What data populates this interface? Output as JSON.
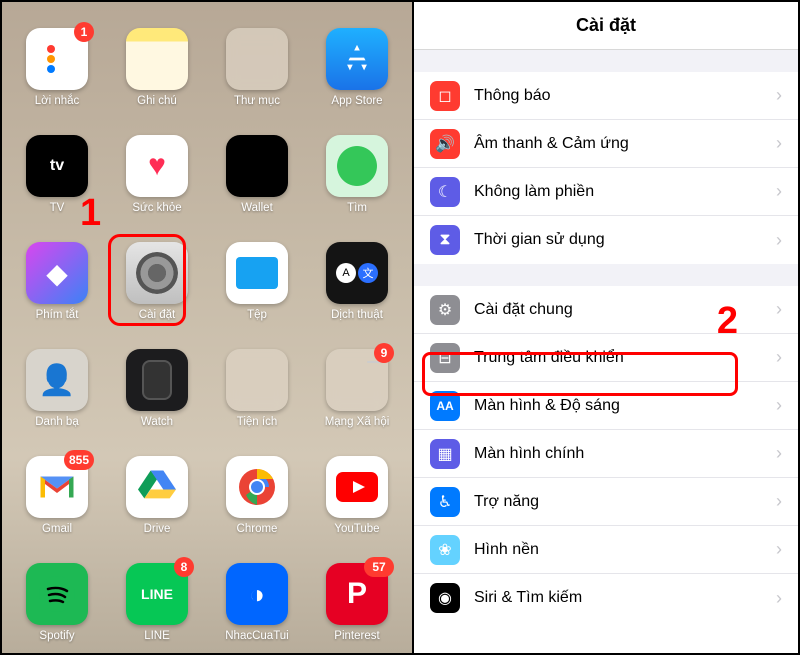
{
  "annotations": {
    "num1": "1",
    "num2": "2"
  },
  "home": {
    "apps": [
      {
        "label": "Lời nhắc",
        "badge": "1"
      },
      {
        "label": "Ghi chú"
      },
      {
        "label": "Thư mục"
      },
      {
        "label": "App Store"
      },
      {
        "label": "TV"
      },
      {
        "label": "Sức khỏe"
      },
      {
        "label": "Wallet"
      },
      {
        "label": "Tìm"
      },
      {
        "label": "Phím tắt"
      },
      {
        "label": "Cài đặt"
      },
      {
        "label": "Tệp"
      },
      {
        "label": "Dịch thuật"
      },
      {
        "label": "Danh bạ"
      },
      {
        "label": "Watch"
      },
      {
        "label": "Tiện ích"
      },
      {
        "label": "Mạng Xã hội",
        "badge": "9"
      },
      {
        "label": "Gmail",
        "badge": "855"
      },
      {
        "label": "Drive"
      },
      {
        "label": "Chrome"
      },
      {
        "label": "YouTube"
      },
      {
        "label": "Spotify"
      },
      {
        "label": "LINE",
        "badge": "8"
      },
      {
        "label": "NhacCuaTui"
      },
      {
        "label": "Pinterest",
        "badge": "57"
      }
    ]
  },
  "settings": {
    "title": "Cài đặt",
    "group1": [
      {
        "icon": "notification-icon",
        "color": "c-red",
        "glyph": "◻",
        "label": "Thông báo"
      },
      {
        "icon": "sound-icon",
        "color": "c-pink",
        "glyph": "🔊",
        "label": "Âm thanh & Cảm ứng"
      },
      {
        "icon": "dnd-icon",
        "color": "c-indigo",
        "glyph": "☾",
        "label": "Không làm phiền"
      },
      {
        "icon": "screentime-icon",
        "color": "c-indigo",
        "glyph": "⧗",
        "label": "Thời gian sử dụng"
      }
    ],
    "group2": [
      {
        "icon": "general-icon",
        "color": "c-gray",
        "glyph": "⚙",
        "label": "Cài đặt chung"
      },
      {
        "icon": "control-center-icon",
        "color": "c-gray",
        "glyph": "⊟",
        "label": "Trung tâm điều khiển"
      },
      {
        "icon": "display-icon",
        "color": "c-blue",
        "glyph": "AA",
        "label": "Màn hình & Độ sáng"
      },
      {
        "icon": "homescreen-icon",
        "color": "c-indigo",
        "glyph": "▦",
        "label": "Màn hình chính"
      },
      {
        "icon": "accessibility-icon",
        "color": "c-blue",
        "glyph": "☯",
        "label": "Trợ năng"
      },
      {
        "icon": "wallpaper-icon",
        "color": "c-teal",
        "glyph": "❀",
        "label": "Hình nền"
      },
      {
        "icon": "siri-icon",
        "color": "c-black",
        "glyph": "◉",
        "label": "Siri & Tìm kiếm"
      }
    ]
  }
}
